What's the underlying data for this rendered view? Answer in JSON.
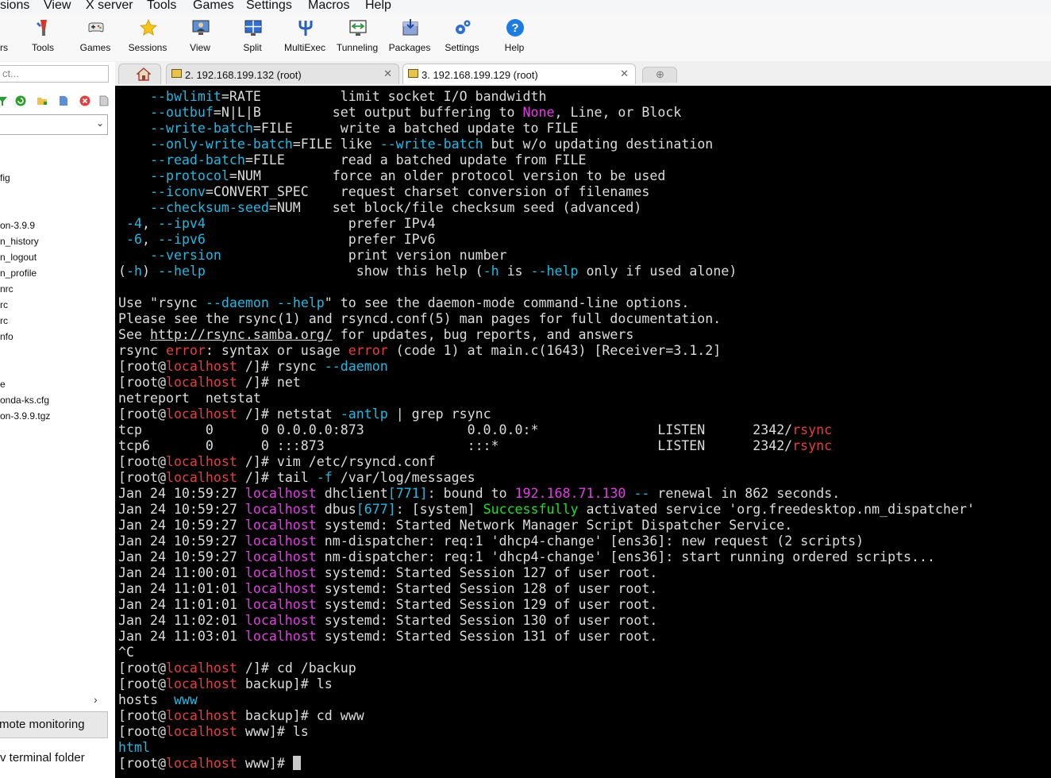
{
  "menubar": [
    "sions",
    "View",
    "X server",
    "Tools",
    "Games",
    "Settings",
    "Macros",
    "Help"
  ],
  "toolbar": {
    "partial_label": "rs",
    "buttons": [
      {
        "label": "Tools",
        "icon": "tools-icon"
      },
      {
        "label": "Games",
        "icon": "gamepad-icon"
      },
      {
        "label": "Sessions",
        "icon": "star-icon"
      },
      {
        "label": "View",
        "icon": "monitor-user-icon"
      },
      {
        "label": "Split",
        "icon": "split-icon"
      },
      {
        "label": "MultiExec",
        "icon": "fork-icon"
      },
      {
        "label": "Tunneling",
        "icon": "tunnel-icon"
      },
      {
        "label": "Packages",
        "icon": "package-icon"
      },
      {
        "label": "Settings",
        "icon": "gears-icon"
      },
      {
        "label": "Help",
        "icon": "help-icon"
      }
    ]
  },
  "sidebar": {
    "quick_connect": "ct...",
    "files": [
      "fig",
      "on-3.9.9",
      "n_history",
      "n_logout",
      "n_profile",
      "nrc",
      "rc",
      "rc",
      "nfo",
      "e",
      "onda-ks.cfg",
      "on-3.9.9.tgz"
    ],
    "remote_monitoring": "mote monitoring",
    "follow_terminal": "v terminal folder"
  },
  "tabs": [
    {
      "label": "2. 192.168.199.132 (root)",
      "active": false
    },
    {
      "label": "3. 192.168.199.129 (root)",
      "active": true
    }
  ],
  "colors": {
    "default": "#dcdcdc",
    "cyan": "#22b8e0",
    "magenta": "#e040e0",
    "red": "#e04040",
    "green": "#22dd22",
    "terminal_bg": "#000000"
  },
  "terminal_lines": [
    [
      [
        "    ",
        "d"
      ],
      [
        "--bwlimit",
        "c"
      ],
      [
        "=RATE          limit socket I/O bandwidth",
        "d"
      ]
    ],
    [
      [
        "    ",
        "d"
      ],
      [
        "--outbuf",
        "c"
      ],
      [
        "=N|L|B         set output buffering to ",
        "d"
      ],
      [
        "None",
        "m"
      ],
      [
        ", Line, or Block",
        "d"
      ]
    ],
    [
      [
        "    ",
        "d"
      ],
      [
        "--write-batch",
        "c"
      ],
      [
        "=FILE      write a batched update to FILE",
        "d"
      ]
    ],
    [
      [
        "    ",
        "d"
      ],
      [
        "--only-write-batch",
        "c"
      ],
      [
        "=FILE like ",
        "d"
      ],
      [
        "--write-batch",
        "c"
      ],
      [
        " but w/o updating destination",
        "d"
      ]
    ],
    [
      [
        "    ",
        "d"
      ],
      [
        "--read-batch",
        "c"
      ],
      [
        "=FILE       read a batched update from FILE",
        "d"
      ]
    ],
    [
      [
        "    ",
        "d"
      ],
      [
        "--protocol",
        "c"
      ],
      [
        "=NUM         force an older protocol version to be used",
        "d"
      ]
    ],
    [
      [
        "    ",
        "d"
      ],
      [
        "--iconv",
        "c"
      ],
      [
        "=CONVERT_SPEC    request charset conversion of filenames",
        "d"
      ]
    ],
    [
      [
        "    ",
        "d"
      ],
      [
        "--checksum-seed",
        "c"
      ],
      [
        "=NUM    set block/file checksum seed (advanced)",
        "d"
      ]
    ],
    [
      [
        " ",
        "d"
      ],
      [
        "-4",
        "c"
      ],
      [
        ", ",
        "d"
      ],
      [
        "--ipv4",
        "c"
      ],
      [
        "                  prefer IPv4",
        "d"
      ]
    ],
    [
      [
        " ",
        "d"
      ],
      [
        "-6",
        "c"
      ],
      [
        ", ",
        "d"
      ],
      [
        "--ipv6",
        "c"
      ],
      [
        "                  prefer IPv6",
        "d"
      ]
    ],
    [
      [
        "    ",
        "d"
      ],
      [
        "--version",
        "c"
      ],
      [
        "                print version number",
        "d"
      ]
    ],
    [
      [
        "(",
        "d"
      ],
      [
        "-h",
        "c"
      ],
      [
        ") ",
        "d"
      ],
      [
        "--help",
        "c"
      ],
      [
        "                   show this help (",
        "d"
      ],
      [
        "-h",
        "c"
      ],
      [
        " is ",
        "d"
      ],
      [
        "--help",
        "c"
      ],
      [
        " only if used alone)",
        "d"
      ]
    ],
    [],
    [
      [
        "Use \"rsync ",
        "d"
      ],
      [
        "--daemon",
        "c"
      ],
      [
        " ",
        "d"
      ],
      [
        "--help",
        "c"
      ],
      [
        "\" to see the daemon-mode command-line options.",
        "d"
      ]
    ],
    [
      [
        "Please see the rsync(1) and rsyncd.conf(5) man pages for full documentation.",
        "d"
      ]
    ],
    [
      [
        "See ",
        "d"
      ],
      [
        "http://rsync.samba.org/",
        "u"
      ],
      [
        " for updates, bug reports, and answers",
        "d"
      ]
    ],
    [
      [
        "rsync ",
        "d"
      ],
      [
        "error",
        "r"
      ],
      [
        ": syntax or usage ",
        "d"
      ],
      [
        "error",
        "r"
      ],
      [
        " (code 1) at main.c(1643) [Receiver=3.1.2]",
        "d"
      ]
    ],
    [
      [
        "[root@",
        "d"
      ],
      [
        "localhost",
        "r"
      ],
      [
        " /]# rsync ",
        "d"
      ],
      [
        "--daemon",
        "c"
      ]
    ],
    [
      [
        "[root@",
        "d"
      ],
      [
        "localhost",
        "r"
      ],
      [
        " /]# net",
        "d"
      ]
    ],
    [
      [
        "netreport  netstat",
        "d"
      ]
    ],
    [
      [
        "[root@",
        "d"
      ],
      [
        "localhost",
        "r"
      ],
      [
        " /]# netstat ",
        "d"
      ],
      [
        "-antlp",
        "c"
      ],
      [
        " | grep rsync",
        "d"
      ]
    ],
    [
      [
        "tcp        0      0 0.0.0.0:873             0.0.0.0:*               LISTEN      2342/",
        "d"
      ],
      [
        "rsync",
        "r"
      ]
    ],
    [
      [
        "tcp6       0      0 :::873                  :::*                    LISTEN      2342/",
        "d"
      ],
      [
        "rsync",
        "r"
      ]
    ],
    [
      [
        "[root@",
        "d"
      ],
      [
        "localhost",
        "r"
      ],
      [
        " /]# vim /etc/rsyncd.conf",
        "d"
      ]
    ],
    [
      [
        "[root@",
        "d"
      ],
      [
        "localhost",
        "r"
      ],
      [
        " /]# tail ",
        "d"
      ],
      [
        "-f",
        "c"
      ],
      [
        " /var/log/messages",
        "d"
      ]
    ],
    [
      [
        "Jan 24 10:59:27 ",
        "d"
      ],
      [
        "localhost",
        "m"
      ],
      [
        " dhclient",
        "d"
      ],
      [
        "[771]",
        "c"
      ],
      [
        ": bound to ",
        "d"
      ],
      [
        "192.168.71.130",
        "m"
      ],
      [
        " ",
        "d"
      ],
      [
        "--",
        "c"
      ],
      [
        " renewal in 862 seconds.",
        "d"
      ]
    ],
    [
      [
        "Jan 24 10:59:27 ",
        "d"
      ],
      [
        "localhost",
        "m"
      ],
      [
        " dbus",
        "d"
      ],
      [
        "[677]",
        "c"
      ],
      [
        ": [system] ",
        "d"
      ],
      [
        "Successfully",
        "g"
      ],
      [
        " activated service 'org.freedesktop.nm_dispatcher'",
        "d"
      ]
    ],
    [
      [
        "Jan 24 10:59:27 ",
        "d"
      ],
      [
        "localhost",
        "m"
      ],
      [
        " systemd: Started Network Manager Script Dispatcher Service.",
        "d"
      ]
    ],
    [
      [
        "Jan 24 10:59:27 ",
        "d"
      ],
      [
        "localhost",
        "m"
      ],
      [
        " nm-dispatcher: req:1 'dhcp4-change' [ens36]: new request (2 scripts)",
        "d"
      ]
    ],
    [
      [
        "Jan 24 10:59:27 ",
        "d"
      ],
      [
        "localhost",
        "m"
      ],
      [
        " nm-dispatcher: req:1 'dhcp4-change' [ens36]: start running ordered scripts...",
        "d"
      ]
    ],
    [
      [
        "Jan 24 11:00:01 ",
        "d"
      ],
      [
        "localhost",
        "m"
      ],
      [
        " systemd: Started Session 127 of user root.",
        "d"
      ]
    ],
    [
      [
        "Jan 24 11:01:01 ",
        "d"
      ],
      [
        "localhost",
        "m"
      ],
      [
        " systemd: Started Session 128 of user root.",
        "d"
      ]
    ],
    [
      [
        "Jan 24 11:01:01 ",
        "d"
      ],
      [
        "localhost",
        "m"
      ],
      [
        " systemd: Started Session 129 of user root.",
        "d"
      ]
    ],
    [
      [
        "Jan 24 11:02:01 ",
        "d"
      ],
      [
        "localhost",
        "m"
      ],
      [
        " systemd: Started Session 130 of user root.",
        "d"
      ]
    ],
    [
      [
        "Jan 24 11:03:01 ",
        "d"
      ],
      [
        "localhost",
        "m"
      ],
      [
        " systemd: Started Session 131 of user root.",
        "d"
      ]
    ],
    [
      [
        "^C",
        "d"
      ]
    ],
    [
      [
        "[root@",
        "d"
      ],
      [
        "localhost",
        "r"
      ],
      [
        " /]# cd /backup",
        "d"
      ]
    ],
    [
      [
        "[root@",
        "d"
      ],
      [
        "localhost",
        "r"
      ],
      [
        " backup]# ls",
        "d"
      ]
    ],
    [
      [
        "hosts  ",
        "d"
      ],
      [
        "www",
        "c"
      ]
    ],
    [
      [
        "[root@",
        "d"
      ],
      [
        "localhost",
        "r"
      ],
      [
        " backup]# cd www",
        "d"
      ]
    ],
    [
      [
        "[root@",
        "d"
      ],
      [
        "localhost",
        "r"
      ],
      [
        " www]# ls",
        "d"
      ]
    ],
    [
      [
        "html",
        "c"
      ]
    ],
    [
      [
        "[root@",
        "d"
      ],
      [
        "localhost",
        "r"
      ],
      [
        " www]# ",
        "d"
      ]
    ]
  ]
}
